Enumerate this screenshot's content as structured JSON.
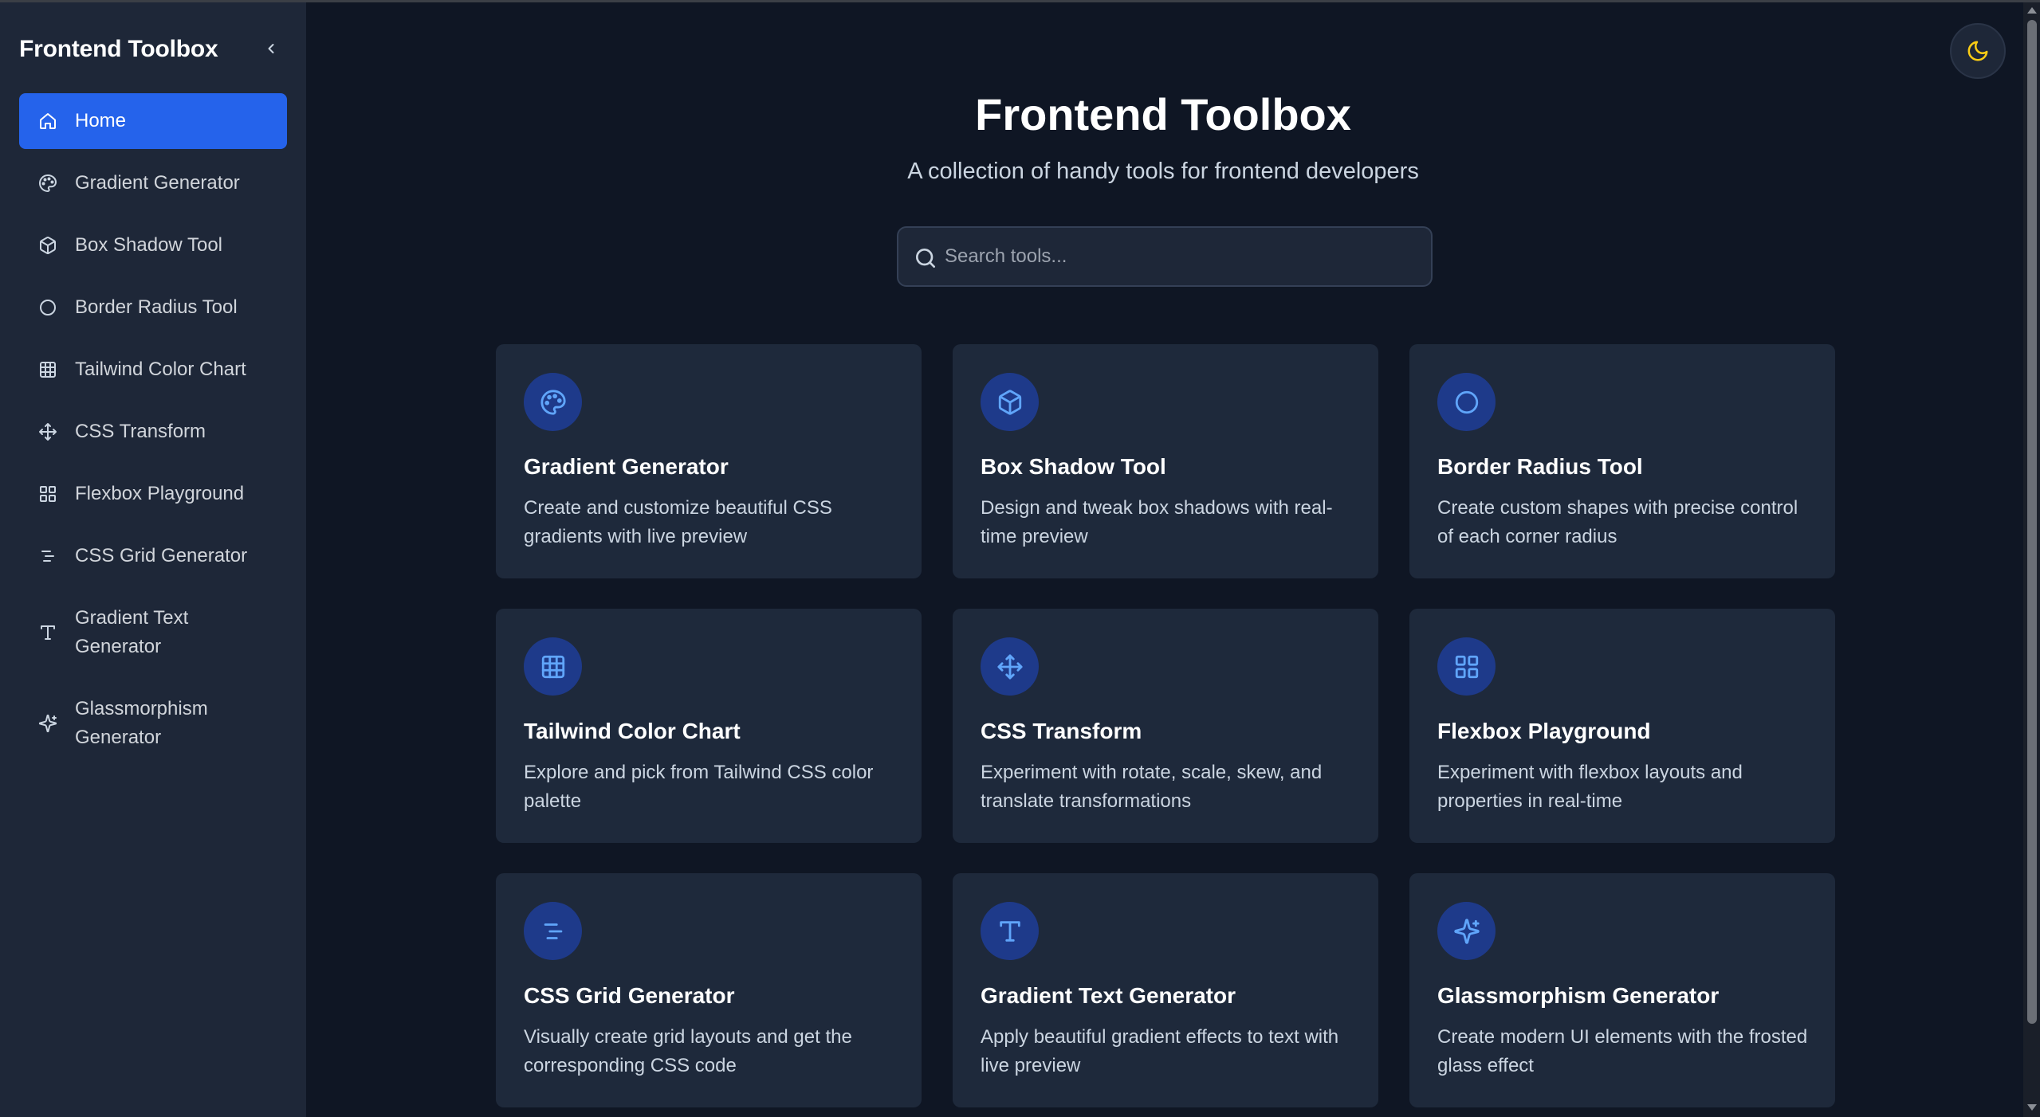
{
  "app": {
    "brand": "Frontend Toolbox",
    "accent_color": "#2563eb",
    "icon_color": "#60a5fa"
  },
  "sidebar": {
    "items": [
      {
        "label": "Home",
        "icon": "home-icon",
        "active": true
      },
      {
        "label": "Gradient Generator",
        "icon": "palette-icon"
      },
      {
        "label": "Box Shadow Tool",
        "icon": "box-icon"
      },
      {
        "label": "Border Radius Tool",
        "icon": "circle-icon"
      },
      {
        "label": "Tailwind Color Chart",
        "icon": "grid-icon"
      },
      {
        "label": "CSS Transform",
        "icon": "move-icon"
      },
      {
        "label": "Flexbox Playground",
        "icon": "layout-grid-icon"
      },
      {
        "label": "CSS Grid Generator",
        "icon": "list-icon"
      },
      {
        "label": "Gradient Text Generator",
        "icon": "type-icon"
      },
      {
        "label": "Glassmorphism Generator",
        "icon": "sparkles-icon"
      }
    ]
  },
  "header": {
    "title": "Frontend Toolbox",
    "subtitle": "A collection of handy tools for frontend developers"
  },
  "search": {
    "placeholder": "Search tools...",
    "value": ""
  },
  "tools": [
    {
      "title": "Gradient Generator",
      "description": "Create and customize beautiful CSS gradients with live preview",
      "icon": "palette-icon"
    },
    {
      "title": "Box Shadow Tool",
      "description": "Design and tweak box shadows with real-time preview",
      "icon": "box-icon"
    },
    {
      "title": "Border Radius Tool",
      "description": "Create custom shapes with precise control of each corner radius",
      "icon": "circle-icon"
    },
    {
      "title": "Tailwind Color Chart",
      "description": "Explore and pick from Tailwind CSS color palette",
      "icon": "grid-icon"
    },
    {
      "title": "CSS Transform",
      "description": "Experiment with rotate, scale, skew, and translate transformations",
      "icon": "move-icon"
    },
    {
      "title": "Flexbox Playground",
      "description": "Experiment with flexbox layouts and properties in real-time",
      "icon": "layout-grid-icon"
    },
    {
      "title": "CSS Grid Generator",
      "description": "Visually create grid layouts and get the corresponding CSS code",
      "icon": "list-icon"
    },
    {
      "title": "Gradient Text Generator",
      "description": "Apply beautiful gradient effects to text with live preview",
      "icon": "type-icon"
    },
    {
      "title": "Glassmorphism Generator",
      "description": "Create modern UI elements with the frosted glass effect",
      "icon": "sparkles-icon"
    }
  ],
  "theme_toggle": {
    "icon": "moon-icon",
    "color": "#facc15"
  }
}
